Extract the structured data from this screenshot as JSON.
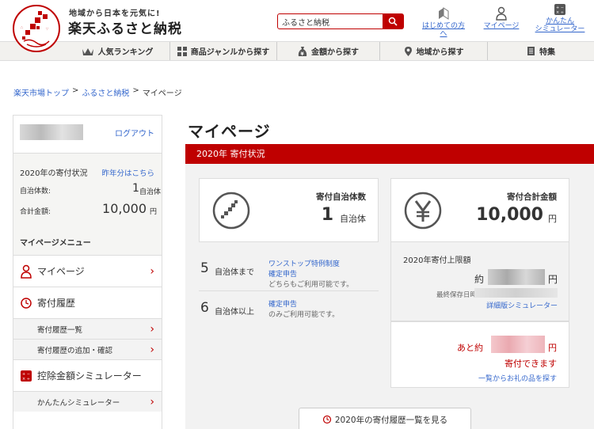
{
  "header": {
    "tagline": "地域から日本を元気に!",
    "brand": "楽天ふるさと納税",
    "search": {
      "value": "ふるさと納税"
    },
    "links": [
      {
        "label": "はじめての方へ",
        "icon": "beginner-leaf-icon"
      },
      {
        "label": "マイページ",
        "icon": "person-icon"
      },
      {
        "label_line1": "かんたん",
        "label_line2": "シミュレーター",
        "icon": "calculator-icon"
      }
    ]
  },
  "nav": [
    {
      "label": "人気ランキング",
      "icon": "crown-icon"
    },
    {
      "label": "商品ジャンルから探す",
      "icon": "grid-icon"
    },
    {
      "label": "金額から探す",
      "icon": "yen-bag-icon"
    },
    {
      "label": "地域から探す",
      "icon": "map-pin-icon"
    },
    {
      "label": "特集",
      "icon": "book-icon"
    }
  ],
  "breadcrumb": [
    {
      "label": "楽天市場トップ",
      "link": true
    },
    {
      "label": ">",
      "link": false
    },
    {
      "label": "ふるさと納税",
      "link": true
    },
    {
      "label": ">",
      "link": false
    },
    {
      "label": "マイページ",
      "link": false
    }
  ],
  "sidebar": {
    "logout": "ログアウト",
    "status_title": "2020年の寄付状況",
    "last_year_link": "昨年分はこちら",
    "municipalities_label": "自治体数:",
    "municipalities_value": "1",
    "municipalities_unit": "自治体",
    "total_label": "合計金額:",
    "total_value": "10,000",
    "total_unit": "円",
    "menu_title": "マイページメニュー",
    "menu": [
      {
        "label": "マイページ",
        "icon": "person-icon"
      },
      {
        "label": "寄付履歴",
        "icon": "history-icon"
      }
    ],
    "sub_history": [
      "寄付履歴一覧",
      "寄付履歴の追加・確認"
    ],
    "simulator": {
      "label": "控除金額シミュレーター",
      "icon": "calculator-icon"
    },
    "sub_simulator": [
      "かんたんシミュレーター"
    ]
  },
  "main": {
    "title": "マイページ",
    "banner": "2020年 寄付状況",
    "count_card": {
      "label": "寄付自治体数",
      "value": "1",
      "unit": "自治体",
      "icon": "japan-map-icon"
    },
    "amount_card": {
      "label": "寄付合計金額",
      "value": "10,000",
      "unit": "円",
      "icon": "yen-icon"
    },
    "info_rows": [
      {
        "num": "5",
        "unit": "自治体まで",
        "link1": "ワンストップ特例制度",
        "link2": "確定申告",
        "note": "どちらもご利用可能です。"
      },
      {
        "num": "6",
        "unit": "自治体以上",
        "link1": "確定申告",
        "note": "のみご利用可能です。"
      }
    ],
    "limit": {
      "label": "2020年寄付上限額",
      "prefix": "約",
      "unit": "円",
      "saved_label": "最終保存日時",
      "detail_link": "詳細版シミュレーター"
    },
    "remaining": {
      "prefix": "あと約",
      "unit": "円",
      "caption": "寄付できます",
      "link": "一覧からお礼の品を探す"
    },
    "history_button": "2020年の寄付履歴一覧を見る"
  },
  "colors": {
    "accent": "#bf0000",
    "link": "#3366cc"
  }
}
